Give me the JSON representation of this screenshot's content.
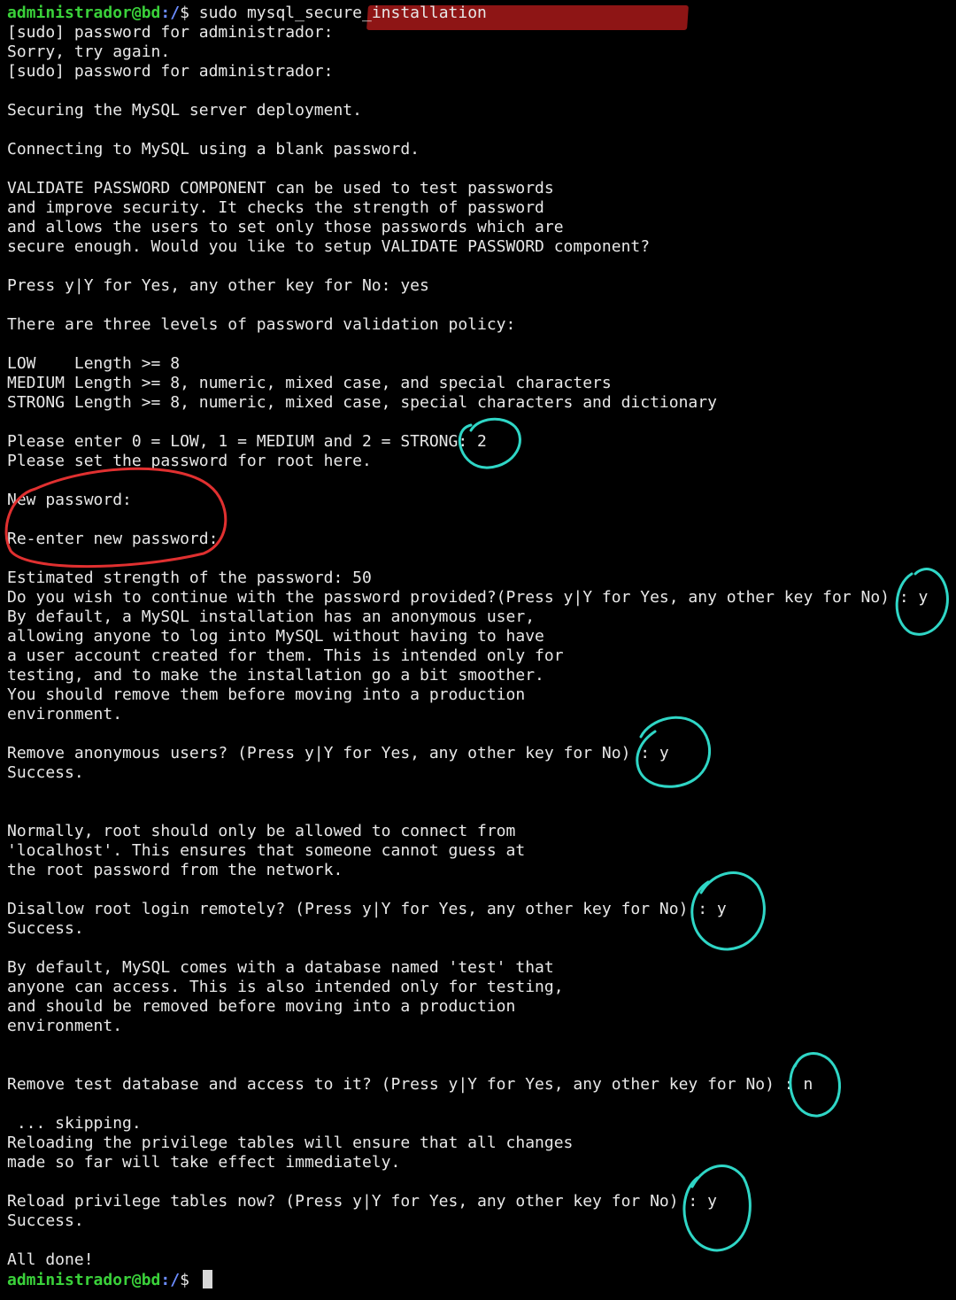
{
  "prompt": {
    "user_host": "administrador@bd",
    "path": ":/",
    "symbol": "$ ",
    "command": "sudo mysql_secure_installation"
  },
  "lines": [
    "[sudo] password for administrador:",
    "Sorry, try again.",
    "[sudo] password for administrador:",
    "",
    "Securing the MySQL server deployment.",
    "",
    "Connecting to MySQL using a blank password.",
    "",
    "VALIDATE PASSWORD COMPONENT can be used to test passwords",
    "and improve security. It checks the strength of password",
    "and allows the users to set only those passwords which are",
    "secure enough. Would you like to setup VALIDATE PASSWORD component?",
    "",
    "Press y|Y for Yes, any other key for No: yes",
    "",
    "There are three levels of password validation policy:",
    "",
    "LOW    Length >= 8",
    "MEDIUM Length >= 8, numeric, mixed case, and special characters",
    "STRONG Length >= 8, numeric, mixed case, special characters and dictionary",
    "",
    "Please enter 0 = LOW, 1 = MEDIUM and 2 = STRONG: 2",
    "Please set the password for root here.",
    "",
    "New password:",
    "",
    "Re-enter new password:",
    "",
    "Estimated strength of the password: 50",
    "Do you wish to continue with the password provided?(Press y|Y for Yes, any other key for No) : y",
    "By default, a MySQL installation has an anonymous user,",
    "allowing anyone to log into MySQL without having to have",
    "a user account created for them. This is intended only for",
    "testing, and to make the installation go a bit smoother.",
    "You should remove them before moving into a production",
    "environment.",
    "",
    "Remove anonymous users? (Press y|Y for Yes, any other key for No) : y",
    "Success.",
    "",
    "",
    "Normally, root should only be allowed to connect from",
    "'localhost'. This ensures that someone cannot guess at",
    "the root password from the network.",
    "",
    "Disallow root login remotely? (Press y|Y for Yes, any other key for No) : y",
    "Success.",
    "",
    "By default, MySQL comes with a database named 'test' that",
    "anyone can access. This is also intended only for testing,",
    "and should be removed before moving into a production",
    "environment.",
    "",
    "",
    "Remove test database and access to it? (Press y|Y for Yes, any other key for No) : n",
    "",
    " ... skipping.",
    "Reloading the privilege tables will ensure that all changes",
    "made so far will take effect immediately.",
    "",
    "Reload privilege tables now? (Press y|Y for Yes, any other key for No) : y",
    "Success.",
    "",
    "All done!"
  ],
  "colors": {
    "prompt_user": "#3ad13a",
    "prompt_path": "#6b8cff",
    "command_highlight": "#8e1515",
    "annotation_red": "#e03030",
    "annotation_cyan": "#2fd6c6"
  }
}
